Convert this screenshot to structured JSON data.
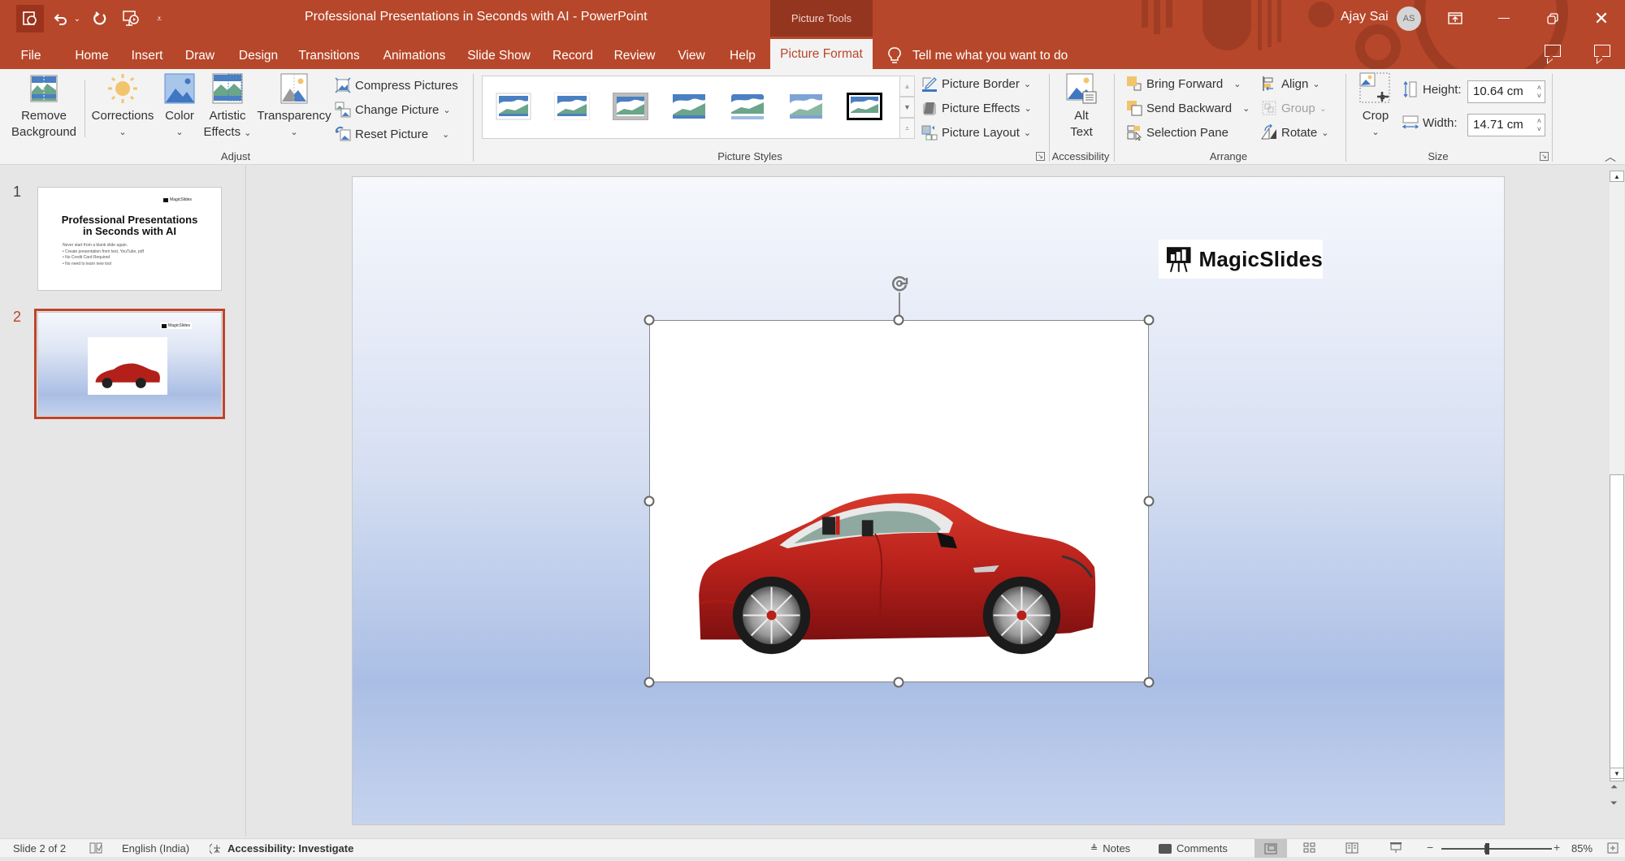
{
  "titlebar": {
    "window_title": "Professional Presentations in Seconds with AI  -  PowerPoint",
    "contextual_group": "Picture Tools",
    "user_name": "Ajay Sai",
    "user_initials": "AS"
  },
  "tabs": [
    {
      "label": "File"
    },
    {
      "label": "Home"
    },
    {
      "label": "Insert"
    },
    {
      "label": "Draw"
    },
    {
      "label": "Design"
    },
    {
      "label": "Transitions"
    },
    {
      "label": "Animations"
    },
    {
      "label": "Slide Show"
    },
    {
      "label": "Record"
    },
    {
      "label": "Review"
    },
    {
      "label": "View"
    },
    {
      "label": "Help"
    },
    {
      "label": "Picture Format",
      "active": true
    }
  ],
  "tell_me": "Tell me what you want to do",
  "ribbon": {
    "adjust": {
      "label": "Adjust",
      "remove_background": [
        "Remove",
        "Background"
      ],
      "corrections": "Corrections",
      "color": "Color",
      "artistic_effects": [
        "Artistic",
        "Effects"
      ],
      "transparency": "Transparency",
      "compress_pictures": "Compress Pictures",
      "change_picture": "Change Picture",
      "reset_picture": "Reset Picture"
    },
    "picture_styles": {
      "label": "Picture Styles",
      "picture_border": "Picture Border",
      "picture_effects": "Picture Effects",
      "picture_layout": "Picture Layout"
    },
    "accessibility": {
      "label": "Accessibility",
      "alt_text": [
        "Alt",
        "Text"
      ]
    },
    "arrange": {
      "label": "Arrange",
      "bring_forward": "Bring Forward",
      "send_backward": "Send Backward",
      "selection_pane": "Selection Pane",
      "align": "Align",
      "group": "Group",
      "rotate": "Rotate"
    },
    "size": {
      "label": "Size",
      "crop": "Crop",
      "height_label": "Height:",
      "height_value": "10.64 cm",
      "width_label": "Width:",
      "width_value": "14.71 cm"
    }
  },
  "slides": [
    {
      "number": "1",
      "logo": "MagicSlides",
      "title": [
        "Professional Presentations",
        "in Seconds with AI"
      ],
      "body": [
        "Never start from a blank slide again.",
        "• Create presentation from text, YouTube, pdf",
        "• No Credit Card Required",
        "• No need to learn new tool"
      ]
    },
    {
      "number": "2",
      "logo": "MagicSlides",
      "selected": true
    }
  ],
  "current_slide": {
    "logo_text": "MagicSlides",
    "picture": "red sports car"
  },
  "statusbar": {
    "slide_info": "Slide 2 of 2",
    "language": "English (India)",
    "accessibility": "Accessibility: Investigate",
    "notes": "Notes",
    "comments": "Comments",
    "zoom": "85%",
    "zoom_percent": 85
  },
  "colors": {
    "accent": "#b7472a",
    "contextual_tab": "#943520",
    "ribbon_bg": "#f3f3f3",
    "selected_thumb_border": "#c0432a"
  }
}
